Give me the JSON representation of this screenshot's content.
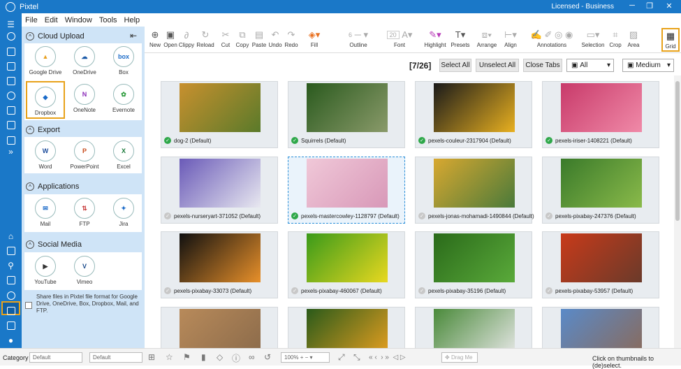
{
  "app": {
    "title": "Pixtel",
    "license": "Licensed - Business"
  },
  "menu": [
    "File",
    "Edit",
    "Window",
    "Tools",
    "Help"
  ],
  "panel": {
    "cloud_upload": "Cloud Upload",
    "cloud_items": [
      {
        "label": "Google Drive",
        "icon": "google-drive-icon"
      },
      {
        "label": "OneDrive",
        "icon": "onedrive-icon"
      },
      {
        "label": "Box",
        "icon": "box-icon"
      },
      {
        "label": "Dropbox",
        "icon": "dropbox-icon"
      },
      {
        "label": "OneNote",
        "icon": "onenote-icon"
      },
      {
        "label": "Evernote",
        "icon": "evernote-icon"
      }
    ],
    "export": "Export",
    "export_items": [
      {
        "label": "Word",
        "icon": "word-icon"
      },
      {
        "label": "PowerPoint",
        "icon": "powerpoint-icon"
      },
      {
        "label": "Excel",
        "icon": "excel-icon"
      }
    ],
    "applications": "Applications",
    "app_items": [
      {
        "label": "Mail",
        "icon": "mail-icon"
      },
      {
        "label": "FTP",
        "icon": "ftp-icon"
      },
      {
        "label": "Jira",
        "icon": "jira-icon"
      }
    ],
    "social": "Social Media",
    "social_items": [
      {
        "label": "YouTube",
        "icon": "youtube-icon"
      },
      {
        "label": "Vimeo",
        "icon": "vimeo-icon"
      }
    ],
    "share_note": "Share files in Pixtel file format for Google Drive, OneDrive, Box, Dropbox, Mail, and FTP."
  },
  "toolbar": [
    {
      "label": "New",
      "glyph": "⊕"
    },
    {
      "label": "Open",
      "glyph": "▣"
    },
    {
      "label": "Clippy",
      "glyph": "📎"
    },
    {
      "label": "Reload",
      "glyph": "↻"
    },
    {
      "label": "Cut",
      "glyph": "✂"
    },
    {
      "label": "Copy",
      "glyph": "⧉"
    },
    {
      "label": "Paste",
      "glyph": "📋"
    },
    {
      "label": "Undo",
      "glyph": "↶"
    },
    {
      "label": "Redo",
      "glyph": "↷"
    },
    {
      "label": "Fill",
      "glyph": "◈"
    },
    {
      "label": "Outline",
      "glyph": "═"
    },
    {
      "label": "Font",
      "glyph": "A"
    },
    {
      "label": "Highlight",
      "glyph": "✎"
    },
    {
      "label": "Presets",
      "glyph": "T"
    },
    {
      "label": "Arrange",
      "glyph": "⧈"
    },
    {
      "label": "Align",
      "glyph": "⊢"
    },
    {
      "label": "Annotations",
      "glyph": "✍"
    },
    {
      "label": "Selection",
      "glyph": "▭"
    },
    {
      "label": "Crop",
      "glyph": "⌗"
    },
    {
      "label": "Area",
      "glyph": "▨"
    },
    {
      "label": "Grid",
      "glyph": "▦"
    }
  ],
  "toolbar_values": {
    "outline_width": "6",
    "font_size": "20"
  },
  "infobar": {
    "counter": "[7/26]",
    "select_all": "Select All",
    "unselect_all": "Unselect All",
    "close_tabs": "Close Tabs",
    "filter": "All",
    "size": "Medium"
  },
  "thumbnails": [
    {
      "label": "dog-2 (Default)",
      "checked": true,
      "colors": [
        "#c8902e",
        "#5a7a2a"
      ]
    },
    {
      "label": "Squirrels (Default)",
      "checked": true,
      "colors": [
        "#2a5a1e",
        "#8a9a6a"
      ]
    },
    {
      "label": "pexels-couleur-2317904 (Default)",
      "checked": true,
      "colors": [
        "#1a1a1a",
        "#e8b020"
      ]
    },
    {
      "label": "pexels-iriser-1408221 (Default)",
      "checked": true,
      "colors": [
        "#c83a6a",
        "#f08aa8"
      ]
    },
    {
      "label": "pexels-nurseryart-371052 (Default)",
      "checked": false,
      "colors": [
        "#6a5ab8",
        "#e8e8f0"
      ]
    },
    {
      "label": "pexels-mastercowley-1128797 (Default)",
      "checked": true,
      "colors": [
        "#f0c8d8",
        "#d898b8"
      ]
    },
    {
      "label": "pexels-jonas-mohamadi-1490844 (Default)",
      "checked": false,
      "colors": [
        "#d8a830",
        "#4a7a3a"
      ]
    },
    {
      "label": "pexels-pixabay-247376 (Default)",
      "checked": false,
      "colors": [
        "#3a7a2a",
        "#8aba4a"
      ]
    },
    {
      "label": "pexels-pixabay-33073 (Default)",
      "checked": false,
      "colors": [
        "#101010",
        "#e8902a"
      ]
    },
    {
      "label": "pexels-pixabay-460067 (Default)",
      "checked": false,
      "colors": [
        "#3a9a1a",
        "#e8d820"
      ]
    },
    {
      "label": "pexels-pixabay-35196 (Default)",
      "checked": false,
      "colors": [
        "#2a6a1a",
        "#5aaa3a"
      ]
    },
    {
      "label": "pexels-pixabay-53957 (Default)",
      "checked": false,
      "colors": [
        "#c83a1a",
        "#6a3a2a"
      ]
    },
    {
      "label": "",
      "checked": false,
      "colors": [
        "#b88a5a",
        "#8a6a4a"
      ]
    },
    {
      "label": "",
      "checked": false,
      "colors": [
        "#2a5a1a",
        "#e8a020"
      ]
    },
    {
      "label": "",
      "checked": false,
      "colors": [
        "#4a8a3a",
        "#e8e8e8"
      ]
    },
    {
      "label": "",
      "checked": false,
      "colors": [
        "#5a8ac8",
        "#8a6a5a"
      ]
    }
  ],
  "status": {
    "category": "Category",
    "default1": "Default",
    "default2": "Default",
    "zoom": "100%",
    "drag": "Drag Me",
    "hint": "Click on thumbnails to (de)select."
  }
}
